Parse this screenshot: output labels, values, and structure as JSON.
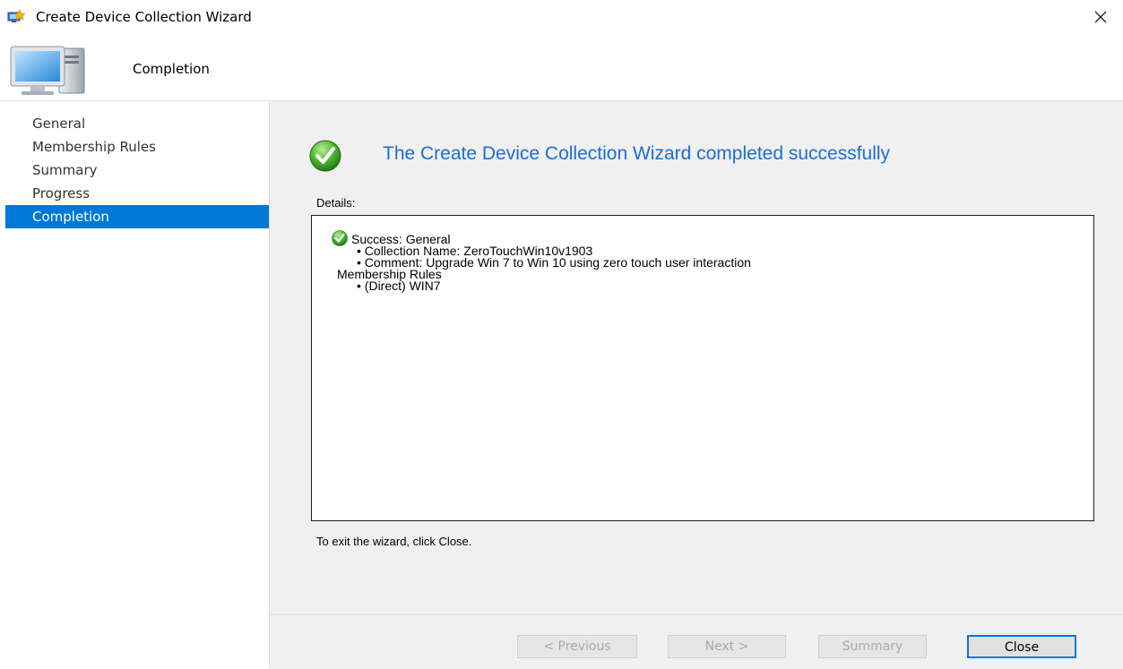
{
  "window": {
    "title": "Create Device Collection Wizard",
    "app_icon": "wizard-icon",
    "close_icon": "close-icon"
  },
  "header": {
    "title": "Completion",
    "icon": "computer-icon"
  },
  "sidebar": {
    "items": [
      {
        "label": "General"
      },
      {
        "label": "Membership Rules"
      },
      {
        "label": "Summary"
      },
      {
        "label": "Progress"
      },
      {
        "label": "Completion",
        "active": true
      }
    ],
    "active_color": "#0078d7"
  },
  "main": {
    "heading": "The Create Device Collection Wizard completed successfully",
    "heading_color": "#1a6fd4",
    "details_label": "Details:",
    "details": {
      "status_line": "Success: General",
      "collection_name": "• Collection Name: ZeroTouchWin10v1903",
      "comment": "• Comment: Upgrade Win 7 to Win 10 using zero touch user interaction",
      "membership_heading": "Membership Rules",
      "membership_rule": "• (Direct) WIN7"
    },
    "exit_hint": "To exit the wizard, click Close."
  },
  "footer": {
    "previous_label": "< Previous",
    "next_label": "Next >",
    "summary_label": "Summary",
    "close_label": "Close"
  }
}
